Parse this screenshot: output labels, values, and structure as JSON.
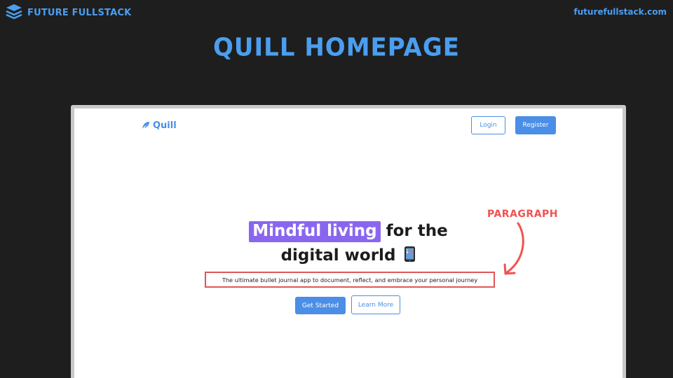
{
  "slide": {
    "brand_name": "FUTURE FULLSTACK",
    "site_url": "futurefullstack.com",
    "title": "QUILL HOMEPAGE"
  },
  "app": {
    "logo_text": "Quill",
    "nav": {
      "login_label": "Login",
      "register_label": "Register"
    },
    "hero": {
      "heading_highlight": "Mindful living",
      "heading_rest_line1": "for the",
      "heading_line2": "digital world",
      "paragraph": "The ultimate bullet journal app to document, reflect, and embrace your personal journey",
      "primary_cta": "Get Started",
      "secondary_cta": "Learn More"
    }
  },
  "annotation": {
    "label": "PARAGRAPH"
  },
  "colors": {
    "background": "#1e1e1e",
    "brand_blue": "#4a9ef0",
    "app_blue": "#4a8ee6",
    "highlight_purple": "#8a66f0",
    "annotation_red": "#ef5350"
  },
  "icons": {
    "brand": "stacked-layers-icon",
    "logo": "feather-quill-icon",
    "emoji": "mobile-phone-icon"
  }
}
